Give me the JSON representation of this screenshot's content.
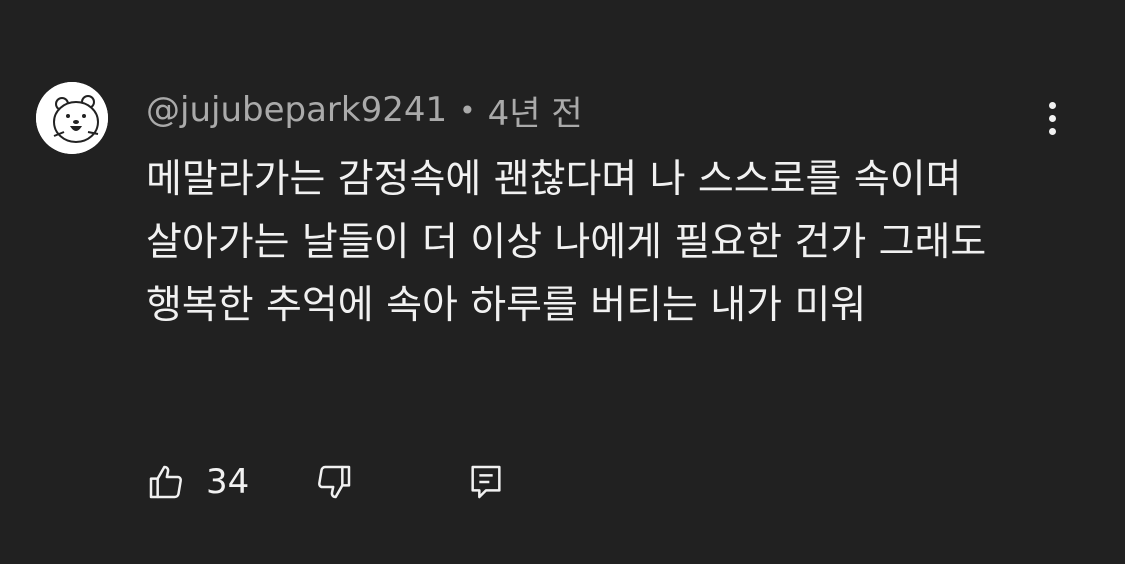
{
  "comment": {
    "author": "@jujubepark9241",
    "separator": "•",
    "time": "4년 전",
    "text": "메말라가는 감정속에 괜찮다며 나 스스로를 속이며  살아가는 날들이 더 이상 나에게 필요한 건가 그래도 행복한 추억에 속아 하루를 버티는 내가 미워",
    "like_count": "34"
  },
  "icons": {
    "avatar": "bear-avatar",
    "menu": "more-vertical-icon",
    "like": "thumbs-up-icon",
    "dislike": "thumbs-down-icon",
    "reply": "reply-comment-icon"
  },
  "colors": {
    "background": "#212121",
    "primary_text": "#f1f1f1",
    "secondary_text": "#aaaaaa"
  }
}
